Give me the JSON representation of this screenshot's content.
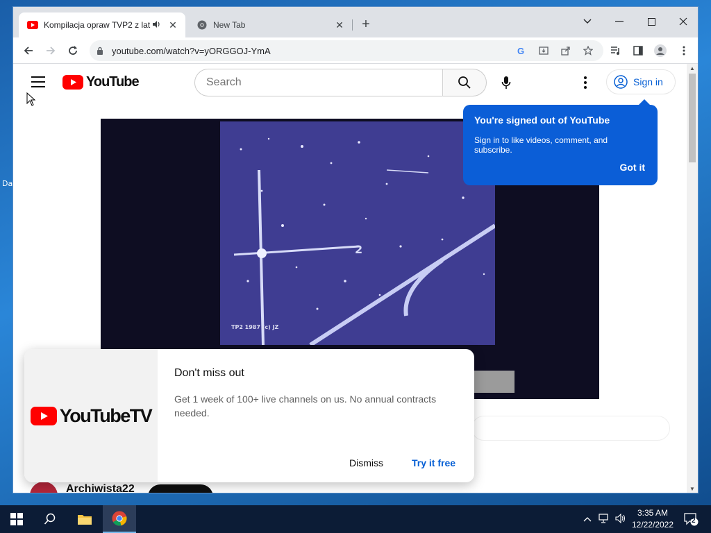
{
  "desktop": {
    "label": "Da"
  },
  "browser": {
    "tabs": [
      {
        "title": "Kompilacja opraw TVP2 z lat",
        "favicon": "youtube-icon",
        "audio": true,
        "active": true
      },
      {
        "title": "New Tab",
        "favicon": "chrome-icon",
        "active": false
      }
    ],
    "url": "youtube.com/watch?v=yORGGOJ-YmA"
  },
  "youtube": {
    "logo_text": "YouTube",
    "search_placeholder": "Search",
    "signin_label": "Sign in",
    "tooltip": {
      "title": "You're signed out of YouTube",
      "body": "Sign in to like videos, comment, and subscribe.",
      "button": "Got it"
    },
    "video": {
      "watermark": "TP2 1987 (c) JZ"
    },
    "channel": {
      "name": "Archiwista22"
    },
    "promo": {
      "logo_text": "YouTubeTV",
      "title": "Don't miss out",
      "body": "Get 1 week of 100+ live channels on us. No annual contracts needed.",
      "dismiss_label": "Dismiss",
      "try_label": "Try it free"
    }
  },
  "taskbar": {
    "time": "3:35 AM",
    "date": "12/22/2022",
    "notification_count": "2"
  }
}
